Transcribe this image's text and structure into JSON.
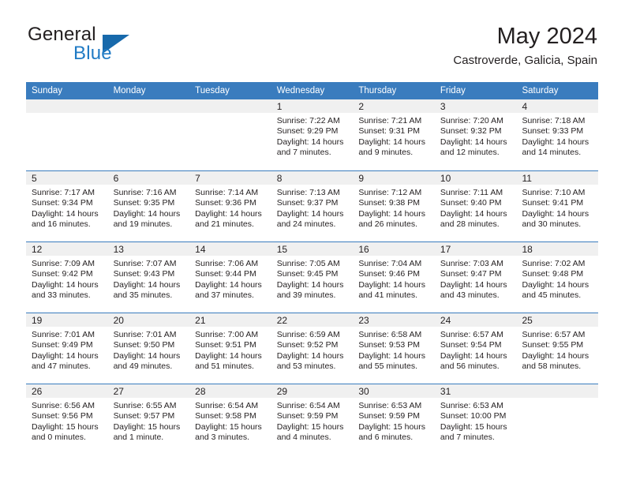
{
  "brand": {
    "line1": "General",
    "line2": "Blue",
    "accent_color": "#1f7ac4",
    "triangle_color": "#1769ab",
    "triangle_icon": "triangle-icon"
  },
  "header": {
    "title": "May 2024",
    "location": "Castroverde, Galicia, Spain"
  },
  "theme": {
    "header_bar_color": "#3a7cbe",
    "day_band_color": "#f0f0f0",
    "text_color": "#231f20"
  },
  "weekday_headers": [
    "Sunday",
    "Monday",
    "Tuesday",
    "Wednesday",
    "Thursday",
    "Friday",
    "Saturday"
  ],
  "weeks": [
    [
      {
        "day": "",
        "sunrise": "",
        "sunset": "",
        "daylight_1": "",
        "daylight_2": ""
      },
      {
        "day": "",
        "sunrise": "",
        "sunset": "",
        "daylight_1": "",
        "daylight_2": ""
      },
      {
        "day": "",
        "sunrise": "",
        "sunset": "",
        "daylight_1": "",
        "daylight_2": ""
      },
      {
        "day": "1",
        "sunrise": "Sunrise: 7:22 AM",
        "sunset": "Sunset: 9:29 PM",
        "daylight_1": "Daylight: 14 hours",
        "daylight_2": "and 7 minutes."
      },
      {
        "day": "2",
        "sunrise": "Sunrise: 7:21 AM",
        "sunset": "Sunset: 9:31 PM",
        "daylight_1": "Daylight: 14 hours",
        "daylight_2": "and 9 minutes."
      },
      {
        "day": "3",
        "sunrise": "Sunrise: 7:20 AM",
        "sunset": "Sunset: 9:32 PM",
        "daylight_1": "Daylight: 14 hours",
        "daylight_2": "and 12 minutes."
      },
      {
        "day": "4",
        "sunrise": "Sunrise: 7:18 AM",
        "sunset": "Sunset: 9:33 PM",
        "daylight_1": "Daylight: 14 hours",
        "daylight_2": "and 14 minutes."
      }
    ],
    [
      {
        "day": "5",
        "sunrise": "Sunrise: 7:17 AM",
        "sunset": "Sunset: 9:34 PM",
        "daylight_1": "Daylight: 14 hours",
        "daylight_2": "and 16 minutes."
      },
      {
        "day": "6",
        "sunrise": "Sunrise: 7:16 AM",
        "sunset": "Sunset: 9:35 PM",
        "daylight_1": "Daylight: 14 hours",
        "daylight_2": "and 19 minutes."
      },
      {
        "day": "7",
        "sunrise": "Sunrise: 7:14 AM",
        "sunset": "Sunset: 9:36 PM",
        "daylight_1": "Daylight: 14 hours",
        "daylight_2": "and 21 minutes."
      },
      {
        "day": "8",
        "sunrise": "Sunrise: 7:13 AM",
        "sunset": "Sunset: 9:37 PM",
        "daylight_1": "Daylight: 14 hours",
        "daylight_2": "and 24 minutes."
      },
      {
        "day": "9",
        "sunrise": "Sunrise: 7:12 AM",
        "sunset": "Sunset: 9:38 PM",
        "daylight_1": "Daylight: 14 hours",
        "daylight_2": "and 26 minutes."
      },
      {
        "day": "10",
        "sunrise": "Sunrise: 7:11 AM",
        "sunset": "Sunset: 9:40 PM",
        "daylight_1": "Daylight: 14 hours",
        "daylight_2": "and 28 minutes."
      },
      {
        "day": "11",
        "sunrise": "Sunrise: 7:10 AM",
        "sunset": "Sunset: 9:41 PM",
        "daylight_1": "Daylight: 14 hours",
        "daylight_2": "and 30 minutes."
      }
    ],
    [
      {
        "day": "12",
        "sunrise": "Sunrise: 7:09 AM",
        "sunset": "Sunset: 9:42 PM",
        "daylight_1": "Daylight: 14 hours",
        "daylight_2": "and 33 minutes."
      },
      {
        "day": "13",
        "sunrise": "Sunrise: 7:07 AM",
        "sunset": "Sunset: 9:43 PM",
        "daylight_1": "Daylight: 14 hours",
        "daylight_2": "and 35 minutes."
      },
      {
        "day": "14",
        "sunrise": "Sunrise: 7:06 AM",
        "sunset": "Sunset: 9:44 PM",
        "daylight_1": "Daylight: 14 hours",
        "daylight_2": "and 37 minutes."
      },
      {
        "day": "15",
        "sunrise": "Sunrise: 7:05 AM",
        "sunset": "Sunset: 9:45 PM",
        "daylight_1": "Daylight: 14 hours",
        "daylight_2": "and 39 minutes."
      },
      {
        "day": "16",
        "sunrise": "Sunrise: 7:04 AM",
        "sunset": "Sunset: 9:46 PM",
        "daylight_1": "Daylight: 14 hours",
        "daylight_2": "and 41 minutes."
      },
      {
        "day": "17",
        "sunrise": "Sunrise: 7:03 AM",
        "sunset": "Sunset: 9:47 PM",
        "daylight_1": "Daylight: 14 hours",
        "daylight_2": "and 43 minutes."
      },
      {
        "day": "18",
        "sunrise": "Sunrise: 7:02 AM",
        "sunset": "Sunset: 9:48 PM",
        "daylight_1": "Daylight: 14 hours",
        "daylight_2": "and 45 minutes."
      }
    ],
    [
      {
        "day": "19",
        "sunrise": "Sunrise: 7:01 AM",
        "sunset": "Sunset: 9:49 PM",
        "daylight_1": "Daylight: 14 hours",
        "daylight_2": "and 47 minutes."
      },
      {
        "day": "20",
        "sunrise": "Sunrise: 7:01 AM",
        "sunset": "Sunset: 9:50 PM",
        "daylight_1": "Daylight: 14 hours",
        "daylight_2": "and 49 minutes."
      },
      {
        "day": "21",
        "sunrise": "Sunrise: 7:00 AM",
        "sunset": "Sunset: 9:51 PM",
        "daylight_1": "Daylight: 14 hours",
        "daylight_2": "and 51 minutes."
      },
      {
        "day": "22",
        "sunrise": "Sunrise: 6:59 AM",
        "sunset": "Sunset: 9:52 PM",
        "daylight_1": "Daylight: 14 hours",
        "daylight_2": "and 53 minutes."
      },
      {
        "day": "23",
        "sunrise": "Sunrise: 6:58 AM",
        "sunset": "Sunset: 9:53 PM",
        "daylight_1": "Daylight: 14 hours",
        "daylight_2": "and 55 minutes."
      },
      {
        "day": "24",
        "sunrise": "Sunrise: 6:57 AM",
        "sunset": "Sunset: 9:54 PM",
        "daylight_1": "Daylight: 14 hours",
        "daylight_2": "and 56 minutes."
      },
      {
        "day": "25",
        "sunrise": "Sunrise: 6:57 AM",
        "sunset": "Sunset: 9:55 PM",
        "daylight_1": "Daylight: 14 hours",
        "daylight_2": "and 58 minutes."
      }
    ],
    [
      {
        "day": "26",
        "sunrise": "Sunrise: 6:56 AM",
        "sunset": "Sunset: 9:56 PM",
        "daylight_1": "Daylight: 15 hours",
        "daylight_2": "and 0 minutes."
      },
      {
        "day": "27",
        "sunrise": "Sunrise: 6:55 AM",
        "sunset": "Sunset: 9:57 PM",
        "daylight_1": "Daylight: 15 hours",
        "daylight_2": "and 1 minute."
      },
      {
        "day": "28",
        "sunrise": "Sunrise: 6:54 AM",
        "sunset": "Sunset: 9:58 PM",
        "daylight_1": "Daylight: 15 hours",
        "daylight_2": "and 3 minutes."
      },
      {
        "day": "29",
        "sunrise": "Sunrise: 6:54 AM",
        "sunset": "Sunset: 9:59 PM",
        "daylight_1": "Daylight: 15 hours",
        "daylight_2": "and 4 minutes."
      },
      {
        "day": "30",
        "sunrise": "Sunrise: 6:53 AM",
        "sunset": "Sunset: 9:59 PM",
        "daylight_1": "Daylight: 15 hours",
        "daylight_2": "and 6 minutes."
      },
      {
        "day": "31",
        "sunrise": "Sunrise: 6:53 AM",
        "sunset": "Sunset: 10:00 PM",
        "daylight_1": "Daylight: 15 hours",
        "daylight_2": "and 7 minutes."
      },
      {
        "day": "",
        "sunrise": "",
        "sunset": "",
        "daylight_1": "",
        "daylight_2": ""
      }
    ]
  ]
}
